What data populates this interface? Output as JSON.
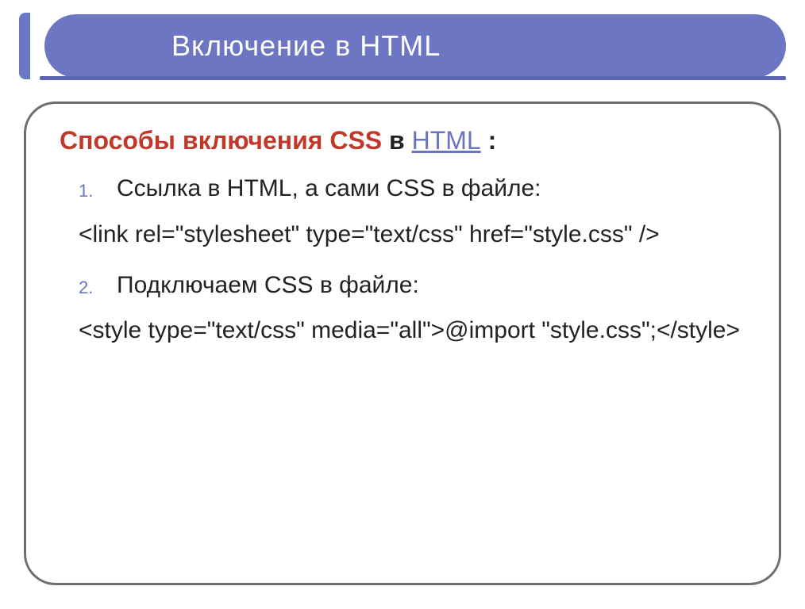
{
  "title": "Включение в HTML",
  "subtitle": {
    "bold_red": "Способы включения CSS",
    "in_text": " в ",
    "link_text": "HTML",
    "after": " :"
  },
  "items": [
    {
      "header": "Ссылка в HTML, а сами CSS в файле:",
      "code": "<link rel=\"stylesheet\" type=\"text/css\" href=\"style.css\" />"
    },
    {
      "header": "Подключаем CSS в файле:",
      "code": "<style type=\"text/css\" media=\"all\">@import \"style.css\";</style>"
    }
  ]
}
